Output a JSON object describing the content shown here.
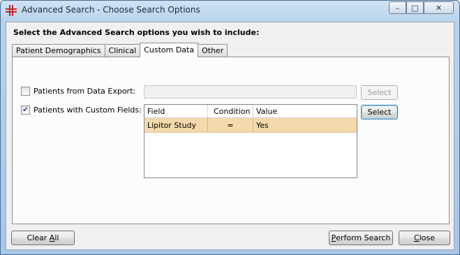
{
  "window": {
    "title": "Advanced Search - Choose Search Options",
    "minimize_glyph": "–",
    "maximize_glyph": "□",
    "close_glyph": "✕"
  },
  "heading": "Select the Advanced Search options you wish to include:",
  "tabs": [
    {
      "label": "Patient Demographics",
      "active": false
    },
    {
      "label": "Clinical",
      "active": false
    },
    {
      "label": "Custom Data",
      "active": true
    },
    {
      "label": "Other",
      "active": false
    }
  ],
  "custom_data": {
    "data_export": {
      "label": "Patients from Data Export:",
      "checked": false,
      "field_value": "",
      "select_label": "Select",
      "enabled": false
    },
    "custom_fields": {
      "label": "Patients with Custom Fields:",
      "checked": true,
      "check_glyph": "✔",
      "select_label": "Select",
      "enabled": true
    },
    "grid": {
      "columns": [
        "Field",
        "Condition",
        "Value"
      ],
      "rows": [
        {
          "field": "Lipitor Study",
          "condition": "=",
          "value": "Yes",
          "selected": true
        }
      ]
    }
  },
  "footer": {
    "clear_all": {
      "label_prefix": "Clear ",
      "mnemonic": "A",
      "label_suffix": "ll"
    },
    "perform_search": {
      "label_prefix": "",
      "mnemonic": "P",
      "label_suffix": "erform Search"
    },
    "close": {
      "label_prefix": "",
      "mnemonic": "C",
      "label_suffix": "lose"
    }
  },
  "colors": {
    "selected_row": "#f3d9ab",
    "accent_red": "#c0282d"
  }
}
